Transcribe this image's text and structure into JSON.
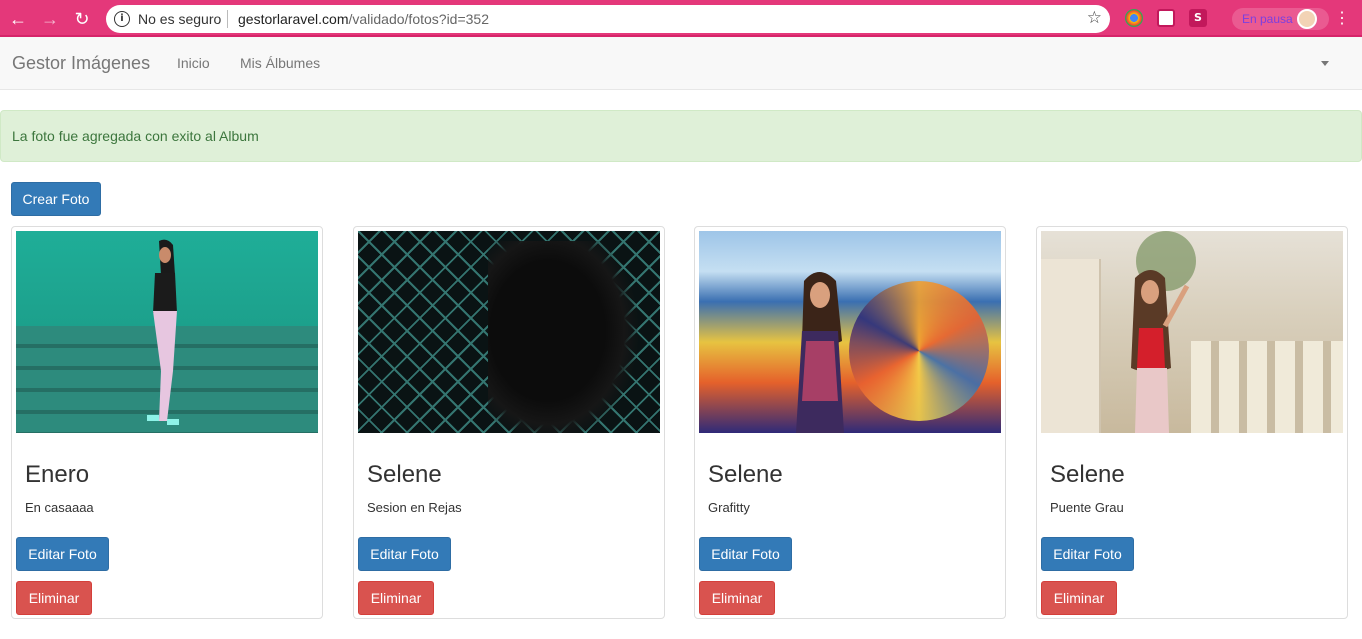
{
  "browser": {
    "security_label": "No es seguro",
    "url_host": "gestorlaravel.com",
    "url_path": "/validado/fotos?id=352",
    "sync_status": "En pausa",
    "theme_color": "#e4387a"
  },
  "navbar": {
    "brand": "Gestor Imágenes",
    "links": [
      "Inicio",
      "Mis Álbumes"
    ]
  },
  "alert": {
    "message": "La foto fue agregada con exito al Album",
    "color": "#dff0d8"
  },
  "actions": {
    "create_label": "Crear Foto"
  },
  "photos": [
    {
      "title": "Enero",
      "description": "En casaaaa",
      "edit_label": "Editar Foto",
      "delete_label": "Eliminar"
    },
    {
      "title": "Selene",
      "description": "Sesion en Rejas",
      "edit_label": "Editar Foto",
      "delete_label": "Eliminar"
    },
    {
      "title": "Selene",
      "description": "Grafitty",
      "edit_label": "Editar Foto",
      "delete_label": "Eliminar"
    },
    {
      "title": "Selene",
      "description": "Puente Grau",
      "edit_label": "Editar Foto",
      "delete_label": "Eliminar"
    }
  ],
  "colors": {
    "primary": "#337ab7",
    "danger": "#d9534f"
  }
}
